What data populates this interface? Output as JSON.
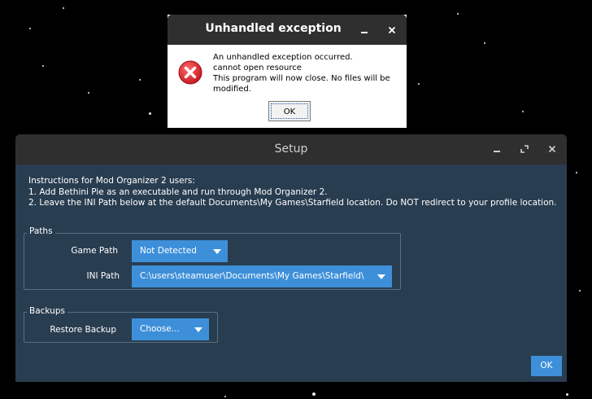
{
  "error_dialog": {
    "title": "Unhandled exception",
    "message_lines": [
      "An unhandled exception occurred.",
      "cannot open resource",
      "This program will now close. No files will be",
      "modified."
    ],
    "ok_label": "OK",
    "icon": "error-icon",
    "icon_color": "#e8202a"
  },
  "setup_window": {
    "title": "Setup",
    "instructions": [
      "Instructions for Mod Organizer 2 users:",
      "1. Add Bethini Pie as an executable and run through Mod Organizer 2.",
      "2. Leave the INI Path below at the default Documents\\My Games\\Starfield location. Do NOT redirect to your profile location."
    ],
    "paths_group": {
      "label": "Paths",
      "game_path_label": "Game Path",
      "game_path_value": "Not Detected",
      "ini_path_label": "INI Path",
      "ini_path_value": "C:\\users\\steamuser\\Documents\\My Games\\Starfield\\"
    },
    "backups_group": {
      "label": "Backups",
      "restore_label": "Restore Backup",
      "restore_value": "Choose..."
    },
    "ok_label": "OK"
  },
  "colors": {
    "window_bg": "#293d50",
    "titlebar_bg": "#2f2f2f",
    "accent": "#3d8fd9",
    "desktop_bg": "#000000"
  }
}
